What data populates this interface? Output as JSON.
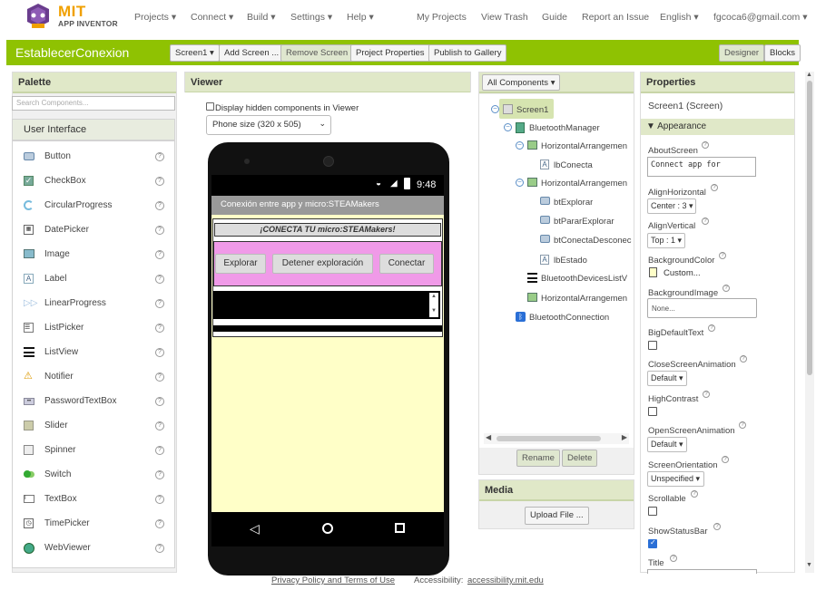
{
  "app": {
    "brand": "MIT",
    "brand_sub": "APP INVENTOR"
  },
  "nav": {
    "projects": "Projects ▾",
    "connect": "Connect ▾",
    "build": "Build ▾",
    "settings": "Settings ▾",
    "help": "Help ▾",
    "my_projects": "My Projects",
    "view_trash": "View Trash",
    "guide": "Guide",
    "report_issue": "Report an Issue",
    "language": "English ▾",
    "user": "fgcoca6@gmail.com ▾"
  },
  "toolbar": {
    "project_name": "EstablecerConexion",
    "screen_select": "Screen1 ▾",
    "add_screen": "Add Screen ...",
    "remove_screen": "Remove Screen",
    "project_properties": "Project Properties",
    "publish": "Publish to Gallery",
    "designer": "Designer",
    "blocks": "Blocks"
  },
  "palette": {
    "title": "Palette",
    "search_placeholder": "Search Components...",
    "category": "User Interface",
    "items": [
      {
        "label": "Button",
        "icon": "button-icon"
      },
      {
        "label": "CheckBox",
        "icon": "checkbox-icon"
      },
      {
        "label": "CircularProgress",
        "icon": "circular-progress-icon"
      },
      {
        "label": "DatePicker",
        "icon": "calendar-icon"
      },
      {
        "label": "Image",
        "icon": "image-icon"
      },
      {
        "label": "Label",
        "icon": "label-icon"
      },
      {
        "label": "LinearProgress",
        "icon": "linear-progress-icon"
      },
      {
        "label": "ListPicker",
        "icon": "list-picker-icon"
      },
      {
        "label": "ListView",
        "icon": "list-view-icon"
      },
      {
        "label": "Notifier",
        "icon": "warning-icon"
      },
      {
        "label": "PasswordTextBox",
        "icon": "password-icon"
      },
      {
        "label": "Slider",
        "icon": "slider-icon"
      },
      {
        "label": "Spinner",
        "icon": "spinner-icon"
      },
      {
        "label": "Switch",
        "icon": "switch-icon"
      },
      {
        "label": "TextBox",
        "icon": "textbox-icon"
      },
      {
        "label": "TimePicker",
        "icon": "clock-icon"
      },
      {
        "label": "WebViewer",
        "icon": "globe-icon"
      }
    ],
    "help_glyph": "?"
  },
  "viewer": {
    "title": "Viewer",
    "hidden_label": "Display hidden components in Viewer",
    "phone_size": "Phone size (320 x 505)",
    "time": "9:48",
    "screen_title": "Conexión entre app y micro:STEAMakers",
    "connect_label": "¡CONECTA TU micro:STEAMakers!",
    "btn_explorar": "Explorar",
    "btn_detener": "Detener exploración",
    "btn_conectar": "Conectar"
  },
  "components": {
    "header": "All Components ▾",
    "tree": [
      {
        "label": "Screen1"
      },
      {
        "label": "BluetoothManager"
      },
      {
        "label": "HorizontalArrangemen"
      },
      {
        "label": "lbConecta"
      },
      {
        "label": "HorizontalArrangemen"
      },
      {
        "label": "btExplorar"
      },
      {
        "label": "btPararExplorar"
      },
      {
        "label": "btConectaDesconec"
      },
      {
        "label": "lbEstado"
      },
      {
        "label": "BluetoothDevicesListV"
      },
      {
        "label": "HorizontalArrangemen"
      },
      {
        "label": "BluetoothConnection"
      }
    ],
    "rename": "Rename",
    "delete": "Delete"
  },
  "media": {
    "title": "Media",
    "upload": "Upload File ..."
  },
  "properties": {
    "title": "Properties",
    "subject": "Screen1 (Screen)",
    "section": "Appearance",
    "about_label": "AboutScreen",
    "about_value": "Connect app for",
    "align_h_label": "AlignHorizontal",
    "align_h_value": "Center : 3 ▾",
    "align_v_label": "AlignVertical",
    "align_v_value": "Top : 1 ▾",
    "bg_color_label": "BackgroundColor",
    "bg_color_value": "Custom...",
    "bg_color": "#ffffc8",
    "bg_image_label": "BackgroundImage",
    "bg_image_value": "None...",
    "big_text_label": "BigDefaultText",
    "close_anim_label": "CloseScreenAnimation",
    "close_anim_value": "Default ▾",
    "high_contrast_label": "HighContrast",
    "open_anim_label": "OpenScreenAnimation",
    "open_anim_value": "Default ▾",
    "orientation_label": "ScreenOrientation",
    "orientation_value": "Unspecified ▾",
    "scrollable_label": "Scrollable",
    "status_bar_label": "ShowStatusBar",
    "title_label": "Title"
  },
  "footer": {
    "privacy": "Privacy Policy and Terms of Use",
    "accessibility_prefix": "Accessibility:",
    "accessibility_link": "accessibility.mit.edu"
  },
  "colors": {
    "brand_green": "#8fc202",
    "brand_orange": "#f0a000",
    "selection_pink": "#f09ae8"
  }
}
